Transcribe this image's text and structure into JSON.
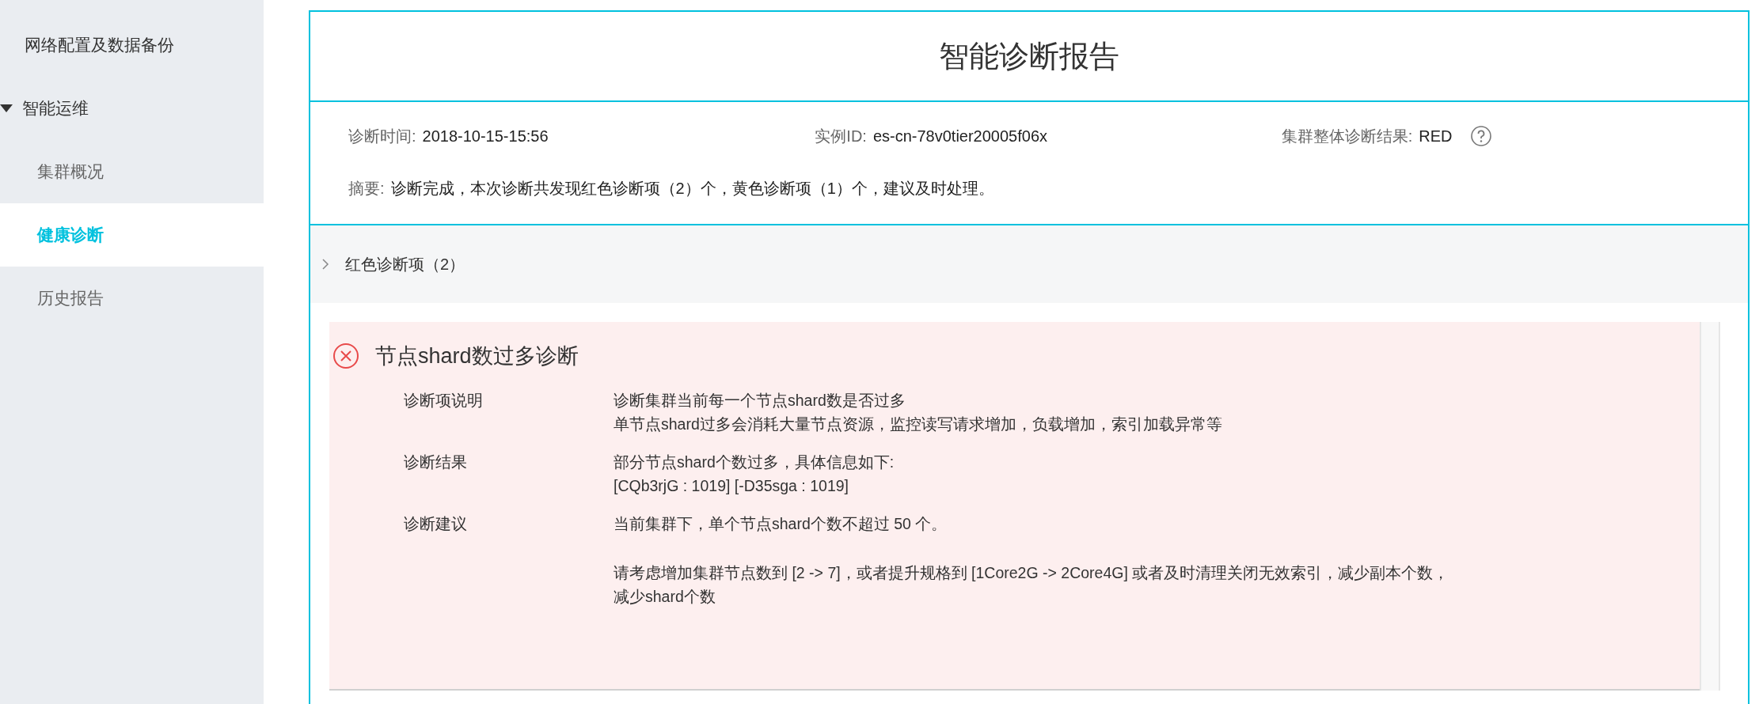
{
  "sidebar": {
    "items": [
      {
        "label": "网络配置及数据备份",
        "selected": false
      },
      {
        "label": "智能运维",
        "expanded": true,
        "selected": false,
        "children": [
          {
            "label": "集群概况",
            "selected": false
          },
          {
            "label": "健康诊断",
            "selected": true
          },
          {
            "label": "历史报告",
            "selected": false
          }
        ]
      }
    ]
  },
  "report": {
    "title": "智能诊断报告",
    "info": [
      {
        "label": "诊断时间:",
        "value": "2018-10-15-15:56"
      },
      {
        "label": "实例ID:",
        "value": "es-cn-78v0tier20005f06x"
      },
      {
        "label": "集群整体诊断结果:",
        "value": "RED",
        "help": true
      }
    ],
    "summary": {
      "label": "摘要:",
      "value": "诊断完成，本次诊断共发现红色诊断项（2）个，黄色诊断项（1）个，建议及时处理。"
    },
    "section": {
      "title": "红色诊断项（2）",
      "cards": [
        {
          "kind": "error",
          "title": "节点shard数过多诊断",
          "rows": [
            {
              "label": "诊断项说明",
              "paragraphs": [
                [
                  "诊断集群当前每一个节点shard数是否过多",
                  "单节点shard过多会消耗大量节点资源，监控读写请求增加，负载增加，索引加载异常等"
                ]
              ]
            },
            {
              "label": "诊断结果",
              "paragraphs": [
                [
                  "部分节点shard个数过多，具体信息如下:",
                  "[CQb3rjG : 1019] [-D35sga : 1019]"
                ]
              ]
            },
            {
              "label": "诊断建议",
              "paragraphs": [
                [
                  "当前集群下，单个节点shard个数不超过 50 个。"
                ],
                [
                  "请考虑增加集群节点数到 [2 -> 7]，或者提升规格到 [1Core2G -> 2Core4G] 或者及时清理关闭无效索引，减少副本个数，",
                  "减少shard个数"
                ]
              ]
            }
          ]
        }
      ]
    }
  }
}
